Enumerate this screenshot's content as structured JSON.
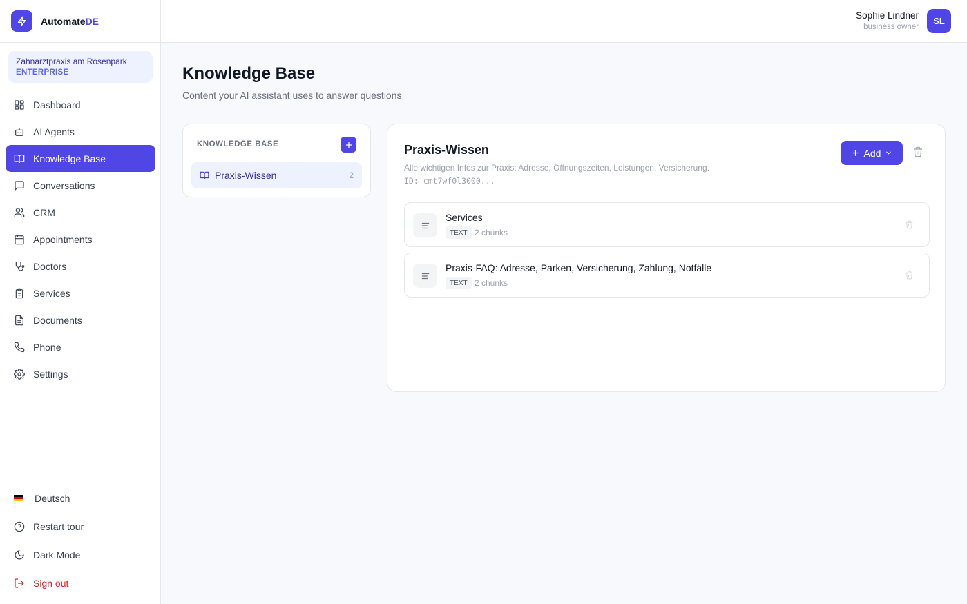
{
  "brand": {
    "name_part1": "Automate",
    "name_part2": "DE"
  },
  "organization": {
    "name": "Zahnarztpraxis am Rosenpark",
    "plan": "ENTERPRISE"
  },
  "sidebar": {
    "items": [
      {
        "label": "Dashboard",
        "icon": "dashboard-icon"
      },
      {
        "label": "AI Agents",
        "icon": "bot-icon"
      },
      {
        "label": "Knowledge Base",
        "icon": "book-icon",
        "active": true
      },
      {
        "label": "Conversations",
        "icon": "chat-icon"
      },
      {
        "label": "CRM",
        "icon": "users-icon"
      },
      {
        "label": "Appointments",
        "icon": "calendar-icon"
      },
      {
        "label": "Doctors",
        "icon": "stethoscope-icon"
      },
      {
        "label": "Services",
        "icon": "clipboard-icon"
      },
      {
        "label": "Documents",
        "icon": "document-icon"
      },
      {
        "label": "Phone",
        "icon": "phone-icon"
      },
      {
        "label": "Settings",
        "icon": "gear-icon"
      }
    ],
    "bottom": {
      "language": "Deutsch",
      "restart_tour": "Restart tour",
      "dark_mode": "Dark Mode",
      "sign_out": "Sign out"
    }
  },
  "header": {
    "user_name": "Sophie Lindner",
    "user_role": "business owner",
    "avatar_initials": "SL"
  },
  "page": {
    "title": "Knowledge Base",
    "subtitle": "Content your AI assistant uses to answer questions"
  },
  "kb_list": {
    "title": "KNOWLEDGE BASE",
    "items": [
      {
        "name": "Praxis-Wissen",
        "count": "2"
      }
    ]
  },
  "detail": {
    "title": "Praxis-Wissen",
    "description": "Alle wichtigen Infos zur Praxis: Adresse, Öffnungszeiten, Leistungen, Versicherung.",
    "id_text": "ID: cmt7wf0l3000...",
    "add_label": "Add",
    "documents": [
      {
        "title": "Services",
        "type": "TEXT",
        "chunks": "2 chunks"
      },
      {
        "title": "Praxis-FAQ: Adresse, Parken, Versicherung, Zahlung, Notfälle",
        "type": "TEXT",
        "chunks": "2 chunks"
      }
    ]
  },
  "colors": {
    "accent": "#4f46e5",
    "accent_light": "#eef2ff",
    "danger": "#dc2626"
  }
}
